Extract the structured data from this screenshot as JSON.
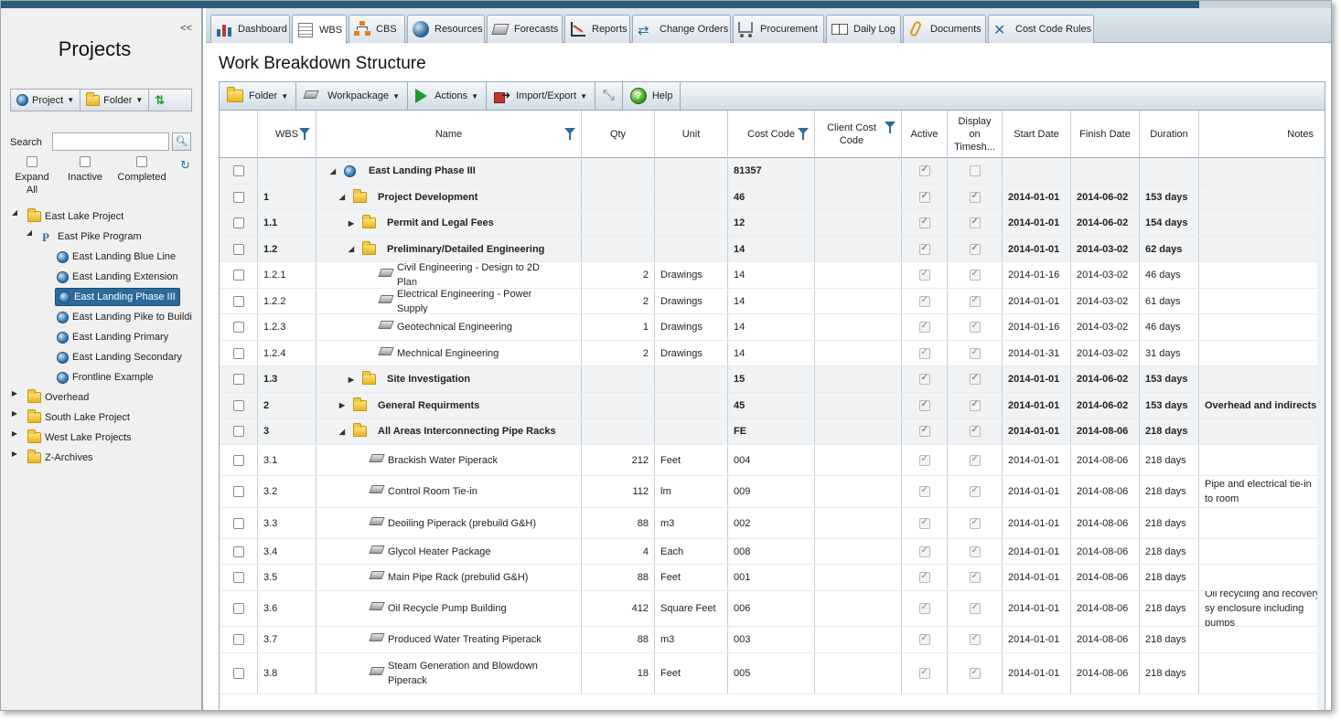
{
  "sidebar": {
    "collapse_label": "<<",
    "title": "Projects",
    "toolbar": {
      "project_label": "Project",
      "folder_label": "Folder"
    },
    "search_label": "Search",
    "search_value": "",
    "filters": {
      "expand_all": "Expand All",
      "inactive": "Inactive",
      "completed": "Completed"
    },
    "tree": [
      {
        "label": "East Lake Project",
        "icon": "folder",
        "level": 0,
        "toggle": "◢"
      },
      {
        "label": "East Pike Program",
        "icon": "program",
        "level": 1,
        "toggle": "◢"
      },
      {
        "label": "East Landing Blue Line",
        "icon": "project",
        "level": 2,
        "toggle": ""
      },
      {
        "label": "East Landing Extension",
        "icon": "project",
        "level": 2,
        "toggle": ""
      },
      {
        "label": "East Landing Phase III",
        "icon": "project",
        "level": 2,
        "toggle": "",
        "selected": true
      },
      {
        "label": "East Landing Pike to Buildi",
        "icon": "project",
        "level": 2,
        "toggle": ""
      },
      {
        "label": "East Landing Primary",
        "icon": "project",
        "level": 2,
        "toggle": ""
      },
      {
        "label": "East Landing Secondary",
        "icon": "project",
        "level": 2,
        "toggle": ""
      },
      {
        "label": "Frontline Example",
        "icon": "project",
        "level": 2,
        "toggle": ""
      },
      {
        "label": "Overhead",
        "icon": "folder",
        "level": 0,
        "toggle": "▶"
      },
      {
        "label": "South Lake Project",
        "icon": "folder",
        "level": 0,
        "toggle": "▶"
      },
      {
        "label": "West Lake Projects",
        "icon": "folder",
        "level": 0,
        "toggle": "▶"
      },
      {
        "label": "Z-Archives",
        "icon": "folder",
        "level": 0,
        "toggle": "▶"
      }
    ]
  },
  "tabs": [
    {
      "label": "Dashboard",
      "icon": "dashboard-icon"
    },
    {
      "label": "WBS",
      "icon": "wbs-icon",
      "active": true
    },
    {
      "label": "CBS",
      "icon": "cbs-icon"
    },
    {
      "label": "Resources",
      "icon": "resources-icon"
    },
    {
      "label": "Forecasts",
      "icon": "forecasts-icon"
    },
    {
      "label": "Reports",
      "icon": "reports-icon"
    },
    {
      "label": "Change Orders",
      "icon": "change-orders-icon"
    },
    {
      "label": "Procurement",
      "icon": "procurement-icon"
    },
    {
      "label": "Daily Log",
      "icon": "daily-log-icon"
    },
    {
      "label": "Documents",
      "icon": "documents-icon"
    },
    {
      "label": "Cost Code Rules",
      "icon": "cost-code-rules-icon"
    }
  ],
  "page_title": "Work Breakdown Structure",
  "actions": {
    "folder": "Folder",
    "workpackage": "Workpackage",
    "actions": "Actions",
    "import_export": "Import/Export",
    "help": "Help"
  },
  "columns": {
    "wbs": "WBS",
    "name": "Name",
    "qty": "Qty",
    "unit": "Unit",
    "cost_code": "Cost Code",
    "client_cost_code": "Client Cost Code",
    "active": "Active",
    "display_on_timesheet": "Display on Timesh...",
    "start_date": "Start Date",
    "finish_date": "Finish Date",
    "duration": "Duration",
    "notes": "Notes"
  },
  "rows": [
    {
      "wbs": "",
      "name": "East Landing Phase III",
      "type": "project",
      "depth": 0,
      "toggle": "◢",
      "qty": "",
      "unit": "",
      "cost_code": "81357",
      "active": true,
      "timesheet": false,
      "start": "",
      "finish": "",
      "duration": "",
      "notes": "",
      "bold": true
    },
    {
      "wbs": "1",
      "name": "Project Development",
      "type": "folder",
      "depth": 1,
      "toggle": "◢",
      "qty": "",
      "unit": "",
      "cost_code": "46",
      "active": true,
      "timesheet": true,
      "start": "2014-01-01",
      "finish": "2014-06-02",
      "duration": "153 days",
      "notes": "",
      "bold": true
    },
    {
      "wbs": "1.1",
      "name": "Permit and Legal Fees",
      "type": "folder",
      "depth": 2,
      "toggle": "▶",
      "qty": "",
      "unit": "",
      "cost_code": "12",
      "active": true,
      "timesheet": true,
      "start": "2014-01-01",
      "finish": "2014-06-02",
      "duration": "154 days",
      "notes": "",
      "bold": true
    },
    {
      "wbs": "1.2",
      "name": "Preliminary/Detailed Engineering",
      "type": "folder",
      "depth": 2,
      "toggle": "◢",
      "qty": "",
      "unit": "",
      "cost_code": "14",
      "active": true,
      "timesheet": true,
      "start": "2014-01-01",
      "finish": "2014-03-02",
      "duration": "62 days",
      "notes": "",
      "bold": true
    },
    {
      "wbs": "1.2.1",
      "name": "Civil Engineering - Design to 2D Plan",
      "type": "wp",
      "depth": 3,
      "toggle": "",
      "qty": "2",
      "unit": "Drawings",
      "cost_code": "14",
      "active": true,
      "timesheet": true,
      "start": "2014-01-16",
      "finish": "2014-03-02",
      "duration": "46 days",
      "notes": ""
    },
    {
      "wbs": "1.2.2",
      "name": "Electrical Engineering - Power Supply",
      "type": "wp",
      "depth": 3,
      "toggle": "",
      "qty": "2",
      "unit": "Drawings",
      "cost_code": "14",
      "active": true,
      "timesheet": true,
      "start": "2014-01-01",
      "finish": "2014-03-02",
      "duration": "61 days",
      "notes": ""
    },
    {
      "wbs": "1.2.3",
      "name": "Geotechnical Engineering",
      "type": "wp",
      "depth": 3,
      "toggle": "",
      "qty": "1",
      "unit": "Drawings",
      "cost_code": "14",
      "active": true,
      "timesheet": true,
      "start": "2014-01-16",
      "finish": "2014-03-02",
      "duration": "46 days",
      "notes": ""
    },
    {
      "wbs": "1.2.4",
      "name": "Mechnical Engineering",
      "type": "wp",
      "depth": 3,
      "toggle": "",
      "qty": "2",
      "unit": "Drawings",
      "cost_code": "14",
      "active": true,
      "timesheet": true,
      "start": "2014-01-31",
      "finish": "2014-03-02",
      "duration": "31 days",
      "notes": ""
    },
    {
      "wbs": "1.3",
      "name": "Site Investigation",
      "type": "folder",
      "depth": 2,
      "toggle": "▶",
      "qty": "",
      "unit": "",
      "cost_code": "15",
      "active": true,
      "timesheet": true,
      "start": "2014-01-01",
      "finish": "2014-06-02",
      "duration": "153 days",
      "notes": "",
      "bold": true
    },
    {
      "wbs": "2",
      "name": "General Requirments",
      "type": "folder",
      "depth": 1,
      "toggle": "▶",
      "qty": "",
      "unit": "",
      "cost_code": "45",
      "active": true,
      "timesheet": true,
      "start": "2014-01-01",
      "finish": "2014-06-02",
      "duration": "153 days",
      "notes": "Overhead and indirects",
      "bold": true
    },
    {
      "wbs": "3",
      "name": "All Areas Interconnecting Pipe Racks",
      "type": "folder",
      "depth": 1,
      "toggle": "◢",
      "qty": "",
      "unit": "",
      "cost_code": "FE",
      "active": true,
      "timesheet": true,
      "start": "2014-01-01",
      "finish": "2014-08-06",
      "duration": "218 days",
      "notes": "",
      "bold": true
    },
    {
      "wbs": "3.1",
      "name": "Brackish Water Piperack",
      "type": "wp",
      "depth": 2,
      "toggle": "",
      "qty": "212",
      "unit": "Feet",
      "cost_code": "004",
      "active": true,
      "timesheet": true,
      "start": "2014-01-01",
      "finish": "2014-08-06",
      "duration": "218 days",
      "notes": ""
    },
    {
      "wbs": "3.2",
      "name": "Control Room Tie-in",
      "type": "wp",
      "depth": 2,
      "toggle": "",
      "qty": "112",
      "unit": "lm",
      "cost_code": "009",
      "active": true,
      "timesheet": true,
      "start": "2014-01-01",
      "finish": "2014-08-06",
      "duration": "218 days",
      "notes": "Pipe and electrical tie-in to room"
    },
    {
      "wbs": "3.3",
      "name": "Deoiling Piperack (prebuild G&H)",
      "type": "wp",
      "depth": 2,
      "toggle": "",
      "qty": "88",
      "unit": "m3",
      "cost_code": "002",
      "active": true,
      "timesheet": true,
      "start": "2014-01-01",
      "finish": "2014-08-06",
      "duration": "218 days",
      "notes": ""
    },
    {
      "wbs": "3.4",
      "name": "Glycol Heater Package",
      "type": "wp",
      "depth": 2,
      "toggle": "",
      "qty": "4",
      "unit": "Each",
      "cost_code": "008",
      "active": true,
      "timesheet": true,
      "start": "2014-01-01",
      "finish": "2014-08-06",
      "duration": "218 days",
      "notes": ""
    },
    {
      "wbs": "3.5",
      "name": "Main Pipe Rack (prebulid G&H)",
      "type": "wp",
      "depth": 2,
      "toggle": "",
      "qty": "88",
      "unit": "Feet",
      "cost_code": "001",
      "active": true,
      "timesheet": true,
      "start": "2014-01-01",
      "finish": "2014-08-06",
      "duration": "218 days",
      "notes": ""
    },
    {
      "wbs": "3.6",
      "name": "Oil Recycle Pump Building",
      "type": "wp",
      "depth": 2,
      "toggle": "",
      "qty": "412",
      "unit": "Square Feet",
      "cost_code": "006",
      "active": true,
      "timesheet": true,
      "start": "2014-01-01",
      "finish": "2014-08-06",
      "duration": "218 days",
      "notes": "Oil recycling and recovery sy enclosure including pumps"
    },
    {
      "wbs": "3.7",
      "name": "Produced Water Treating Piperack",
      "type": "wp",
      "depth": 2,
      "toggle": "",
      "qty": "88",
      "unit": "m3",
      "cost_code": "003",
      "active": true,
      "timesheet": true,
      "start": "2014-01-01",
      "finish": "2014-08-06",
      "duration": "218 days",
      "notes": ""
    },
    {
      "wbs": "3.8",
      "name": "Steam Generation and Blowdown Piperack",
      "type": "wp",
      "depth": 2,
      "toggle": "",
      "qty": "18",
      "unit": "Feet",
      "cost_code": "005",
      "active": true,
      "timesheet": true,
      "start": "2014-01-01",
      "finish": "2014-08-06",
      "duration": "218 days",
      "notes": ""
    }
  ],
  "colors": {
    "accent": "#2d6a99",
    "header_strip": "#2d5b7a",
    "bold_row_bg": "#f0f2f4"
  }
}
